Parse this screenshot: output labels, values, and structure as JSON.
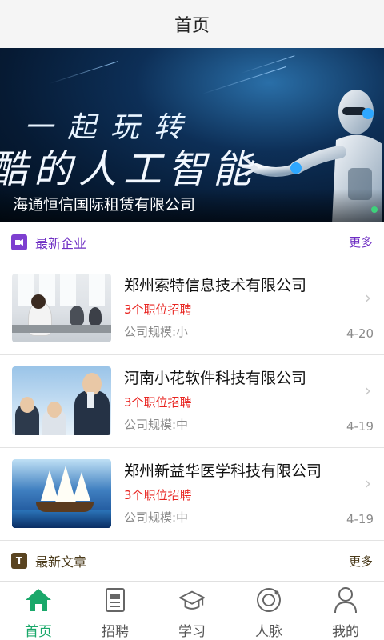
{
  "header": {
    "title": "首页"
  },
  "banner": {
    "slogan_line1": "一起玩转",
    "slogan_line2": "酷的人工智能",
    "caption": "海通恒信国际租赁有限公司"
  },
  "section_companies": {
    "title": "最新企业",
    "more": "更多",
    "icon": "enterprise-icon",
    "color": "#7e3fd0"
  },
  "companies": [
    {
      "name": "郑州索特信息技术有限公司",
      "jobs": "3个职位招聘",
      "scale": "公司规模:小",
      "date": "4-20"
    },
    {
      "name": "河南小花软件科技有限公司",
      "jobs": "3个职位招聘",
      "scale": "公司规模:中",
      "date": "4-19"
    },
    {
      "name": "郑州新益华医学科技有限公司",
      "jobs": "3个职位招聘",
      "scale": "公司规模:中",
      "date": "4-19"
    }
  ],
  "section_articles": {
    "title": "最新文章",
    "more": "更多",
    "icon_letter": "T",
    "color": "#5a4421"
  },
  "tabs": [
    {
      "label": "首页",
      "icon": "home-icon",
      "active": true
    },
    {
      "label": "招聘",
      "icon": "document-icon",
      "active": false
    },
    {
      "label": "学习",
      "icon": "graduation-cap-icon",
      "active": false
    },
    {
      "label": "人脉",
      "icon": "orbit-icon",
      "active": false
    },
    {
      "label": "我的",
      "icon": "person-icon",
      "active": false
    }
  ],
  "colors": {
    "accent_green": "#1aa86a",
    "job_red": "#e8231f",
    "company_purple": "#6f2fc4"
  }
}
